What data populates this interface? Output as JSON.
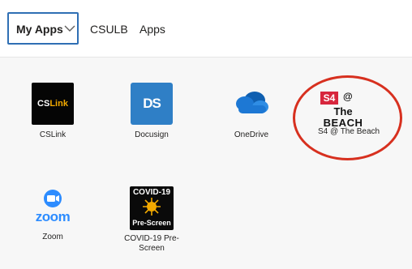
{
  "tabs": {
    "myapps_label": "My Apps",
    "csulb_label": "CSULB",
    "apps_label": "Apps"
  },
  "apps": [
    {
      "name": "CSLink",
      "icon": "cslink-logo"
    },
    {
      "name": "Docusign",
      "icon": "docusign-logo"
    },
    {
      "name": "OneDrive",
      "icon": "cloud-icon"
    },
    {
      "name": "S4 @ The Beach",
      "icon": "s4-beach-logo"
    },
    {
      "name": "Zoom",
      "icon": "zoom-logo"
    },
    {
      "name": "COVID-19 Pre-Screen",
      "icon": "covid-prescreen-logo"
    }
  ],
  "logos": {
    "cslink_text_a": "CS",
    "cslink_text_b": "Link",
    "docusign_text": "DS",
    "s4_badge": "S4",
    "s4_at": "@",
    "s4_the": "The",
    "s4_beach": "BEACH",
    "zoom_word": "zoom",
    "covid_top": "COVID-19",
    "covid_bottom": "Pre-Screen"
  },
  "colors": {
    "accent_border": "#2f6fb4",
    "highlight_ring": "#d7301f",
    "onedrive_blue": "#1d78d4",
    "zoom_blue": "#2d8cff",
    "docusign_blue": "#2f7fc6",
    "s4_red": "#d7263d"
  }
}
